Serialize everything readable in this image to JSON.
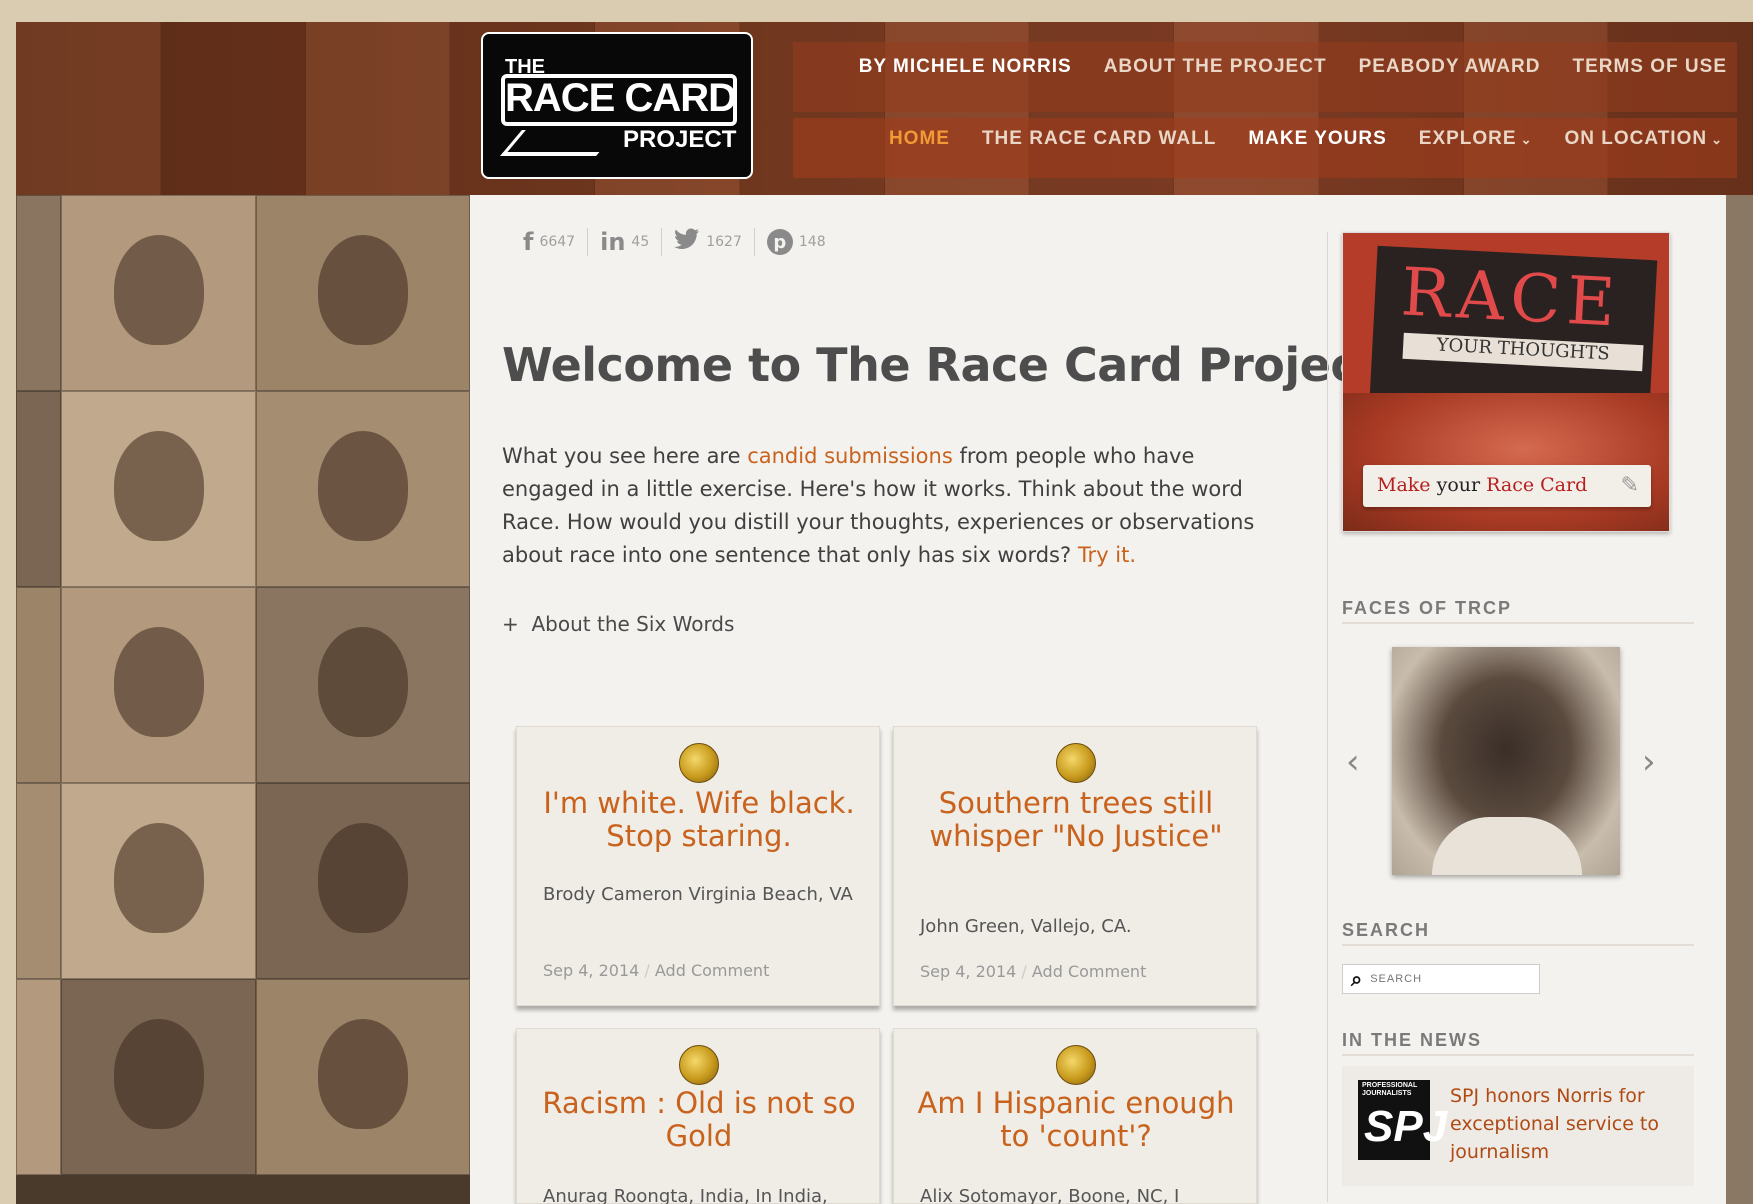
{
  "logo": {
    "line1": "THE",
    "line2": "RACE CARD",
    "line3": "PROJECT"
  },
  "top_nav": [
    "BY MICHELE NORRIS",
    "ABOUT THE PROJECT",
    "PEABODY AWARD",
    "TERMS OF USE"
  ],
  "main_nav": {
    "home": "HOME",
    "wall": "THE RACE CARD WALL",
    "make": "MAKE YOURS",
    "explore": "EXPLORE",
    "on_location": "ON LOCATION"
  },
  "share": {
    "facebook": "6647",
    "linkedin": "45",
    "twitter": "1627",
    "pinterest": "148"
  },
  "page_title": "Welcome to The Race Card Project",
  "intro": {
    "p1": "What you see here are ",
    "link1": "candid submissions",
    "p2": " from people who have engaged in a little exercise. Here's how it works. Think about the word Race. How would you distill your thoughts, experiences or observations about race into one sentence that only has six words? ",
    "link2": "Try it."
  },
  "about_six_words": "About the Six Words",
  "cards": [
    {
      "quote": "I'm white. Wife black. Stop staring.",
      "author": "Brody Cameron Virginia Beach, VA",
      "date": "Sep 4, 2014",
      "comment": "Add Comment"
    },
    {
      "quote": "Southern trees still whisper \"No Justice\"",
      "author": "John Green, Vallejo, CA.",
      "date": "Sep 4, 2014",
      "comment": "Add Comment"
    },
    {
      "quote": "Racism : Old is not so Gold",
      "author": "Anurag Roongta, India, In India,"
    },
    {
      "quote": "Am I Hispanic enough to 'count'?",
      "author": "Alix Sotomayor, Boone, NC, I"
    }
  ],
  "promo": {
    "race_word": "RACE",
    "card_text": "YOUR THOUGHTS",
    "cta_make": "Make",
    "cta_your": " your ",
    "cta_race_card": "Race Card"
  },
  "sidebar": {
    "faces_heading": "FACES OF TRCP",
    "search_heading": "SEARCH",
    "search_placeholder": "SEARCH",
    "news_heading": "IN THE NEWS",
    "news_logo_small": "PROFESSIONAL JOURNALISTS",
    "news_logo_big": "SPJ",
    "news_text": "SPJ honors Norris for exceptional service to journalism"
  },
  "colors": {
    "accent_orange": "#c8621c",
    "active_nav": "#f39a36",
    "header_brown": "#7a3c22"
  }
}
